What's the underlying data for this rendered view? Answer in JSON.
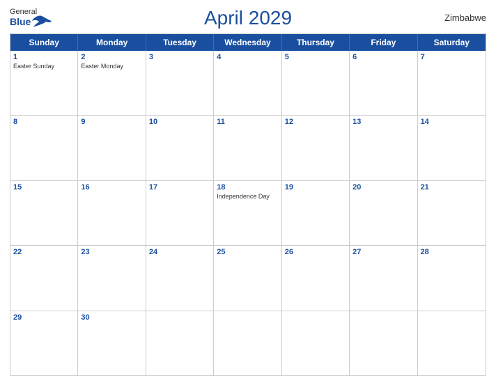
{
  "header": {
    "title": "April 2029",
    "country": "Zimbabwe",
    "logo": {
      "general": "General",
      "blue": "Blue"
    }
  },
  "calendar": {
    "days_of_week": [
      "Sunday",
      "Monday",
      "Tuesday",
      "Wednesday",
      "Thursday",
      "Friday",
      "Saturday"
    ],
    "weeks": [
      [
        {
          "day": 1,
          "holiday": "Easter Sunday"
        },
        {
          "day": 2,
          "holiday": "Easter Monday"
        },
        {
          "day": 3,
          "holiday": ""
        },
        {
          "day": 4,
          "holiday": ""
        },
        {
          "day": 5,
          "holiday": ""
        },
        {
          "day": 6,
          "holiday": ""
        },
        {
          "day": 7,
          "holiday": ""
        }
      ],
      [
        {
          "day": 8,
          "holiday": ""
        },
        {
          "day": 9,
          "holiday": ""
        },
        {
          "day": 10,
          "holiday": ""
        },
        {
          "day": 11,
          "holiday": ""
        },
        {
          "day": 12,
          "holiday": ""
        },
        {
          "day": 13,
          "holiday": ""
        },
        {
          "day": 14,
          "holiday": ""
        }
      ],
      [
        {
          "day": 15,
          "holiday": ""
        },
        {
          "day": 16,
          "holiday": ""
        },
        {
          "day": 17,
          "holiday": ""
        },
        {
          "day": 18,
          "holiday": "Independence Day"
        },
        {
          "day": 19,
          "holiday": ""
        },
        {
          "day": 20,
          "holiday": ""
        },
        {
          "day": 21,
          "holiday": ""
        }
      ],
      [
        {
          "day": 22,
          "holiday": ""
        },
        {
          "day": 23,
          "holiday": ""
        },
        {
          "day": 24,
          "holiday": ""
        },
        {
          "day": 25,
          "holiday": ""
        },
        {
          "day": 26,
          "holiday": ""
        },
        {
          "day": 27,
          "holiday": ""
        },
        {
          "day": 28,
          "holiday": ""
        }
      ],
      [
        {
          "day": 29,
          "holiday": ""
        },
        {
          "day": 30,
          "holiday": ""
        },
        {
          "day": null,
          "holiday": ""
        },
        {
          "day": null,
          "holiday": ""
        },
        {
          "day": null,
          "holiday": ""
        },
        {
          "day": null,
          "holiday": ""
        },
        {
          "day": null,
          "holiday": ""
        }
      ]
    ]
  }
}
